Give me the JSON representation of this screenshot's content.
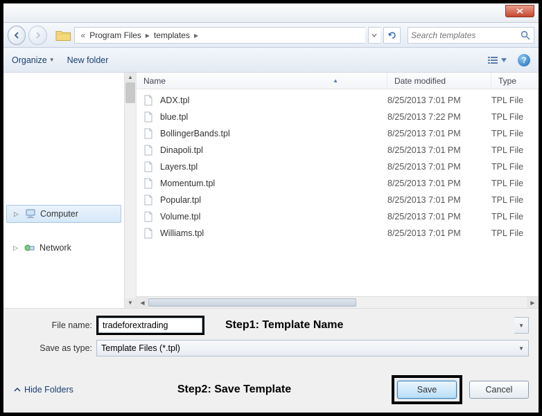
{
  "titlebar": {
    "close": "✕"
  },
  "breadcrumb": {
    "parts": [
      "Program Files",
      "templates"
    ]
  },
  "search": {
    "placeholder": "Search templates"
  },
  "toolbar": {
    "organize": "Organize",
    "new_folder": "New folder"
  },
  "sidebar": {
    "computer": "Computer",
    "network": "Network"
  },
  "columns": {
    "name": "Name",
    "date": "Date modified",
    "type": "Type"
  },
  "files": [
    {
      "name": "ADX.tpl",
      "date": "8/25/2013 7:01 PM",
      "type": "TPL File"
    },
    {
      "name": "blue.tpl",
      "date": "8/25/2013 7:22 PM",
      "type": "TPL File"
    },
    {
      "name": "BollingerBands.tpl",
      "date": "8/25/2013 7:01 PM",
      "type": "TPL File"
    },
    {
      "name": "Dinapoli.tpl",
      "date": "8/25/2013 7:01 PM",
      "type": "TPL File"
    },
    {
      "name": "Layers.tpl",
      "date": "8/25/2013 7:01 PM",
      "type": "TPL File"
    },
    {
      "name": "Momentum.tpl",
      "date": "8/25/2013 7:01 PM",
      "type": "TPL File"
    },
    {
      "name": "Popular.tpl",
      "date": "8/25/2013 7:01 PM",
      "type": "TPL File"
    },
    {
      "name": "Volume.tpl",
      "date": "8/25/2013 7:01 PM",
      "type": "TPL File"
    },
    {
      "name": "Williams.tpl",
      "date": "8/25/2013 7:01 PM",
      "type": "TPL File"
    }
  ],
  "bottom": {
    "file_name_label": "File name:",
    "file_name_value": "tradeforextrading",
    "save_type_label": "Save as type:",
    "save_type_value": "Template Files (*.tpl)",
    "step1": "Step1: Template Name",
    "step2": "Step2: Save Template",
    "hide_folders": "Hide Folders",
    "save": "Save",
    "cancel": "Cancel"
  }
}
